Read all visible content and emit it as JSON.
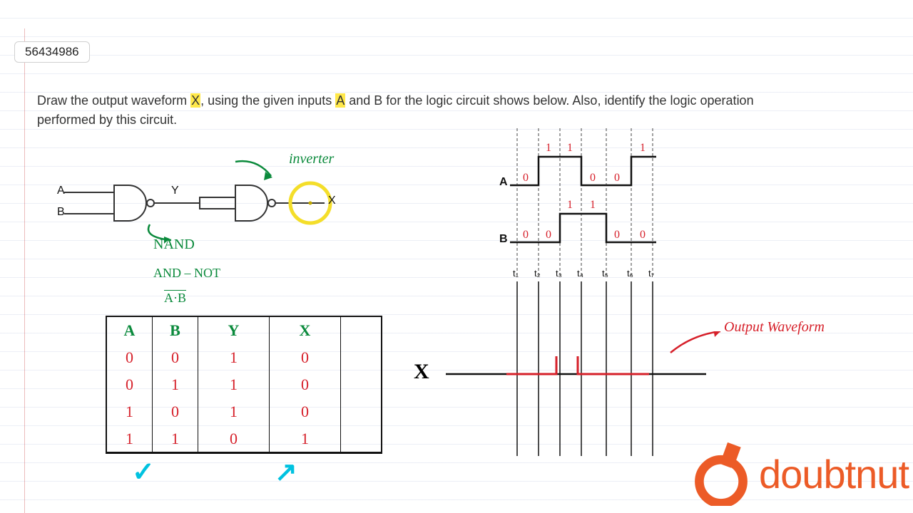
{
  "problem_id": "56434986",
  "question_parts": {
    "p1": "Draw the output waveform ",
    "x": "X",
    "p2": ", using the given inputs ",
    "a": "A",
    "p3": " and B for the logic circuit shows below. Also, identify the logic operation performed by this circuit."
  },
  "circuit": {
    "inputA": "A",
    "inputB": "B",
    "mid": "Y",
    "out": "X"
  },
  "annotations": {
    "inverter": "inverter",
    "nand": "NAND",
    "and_not": "AND – NOT",
    "ab_bar": "A·B",
    "output_wave": "Output Waveform"
  },
  "truth_table": {
    "headers": [
      "A",
      "B",
      "Y",
      "X",
      ""
    ],
    "rows": [
      [
        "0",
        "0",
        "1",
        "0",
        ""
      ],
      [
        "0",
        "1",
        "1",
        "0",
        ""
      ],
      [
        "1",
        "0",
        "1",
        "0",
        ""
      ],
      [
        "1",
        "1",
        "0",
        "1",
        ""
      ]
    ]
  },
  "waveforms": {
    "A_labels": [
      "0",
      "1",
      "1",
      "0",
      "0",
      "1"
    ],
    "B_labels": [
      "0",
      "0",
      "1",
      "1",
      "0",
      "0"
    ],
    "t_labels": [
      "t₁",
      "t₂",
      "t₃",
      "t₄",
      "t₅",
      "t₆",
      "t₇"
    ],
    "X_label": "X"
  },
  "logo_text": "doubtnut",
  "colors": {
    "green": "#0b8a3c",
    "red": "#d6202a",
    "yellow": "#f4de2a",
    "cyan": "#00c2e0",
    "orange": "#ec5b27"
  },
  "chart_data": {
    "type": "table",
    "title": "Truth table and timing diagram for NAND followed by inverter (equivalent to AND)",
    "truth_table": [
      {
        "A": 0,
        "B": 0,
        "Y": 1,
        "X": 0
      },
      {
        "A": 0,
        "B": 1,
        "Y": 1,
        "X": 0
      },
      {
        "A": 1,
        "B": 0,
        "Y": 1,
        "X": 0
      },
      {
        "A": 1,
        "B": 1,
        "Y": 0,
        "X": 1
      }
    ],
    "timing": {
      "intervals": [
        "t1-t2",
        "t2-t3",
        "t3-t4",
        "t4-t5",
        "t5-t6",
        "t6-t7"
      ],
      "A": [
        0,
        1,
        1,
        0,
        0,
        1
      ],
      "B": [
        0,
        0,
        1,
        1,
        0,
        0
      ],
      "X": [
        0,
        0,
        1,
        0,
        0,
        0
      ]
    }
  }
}
